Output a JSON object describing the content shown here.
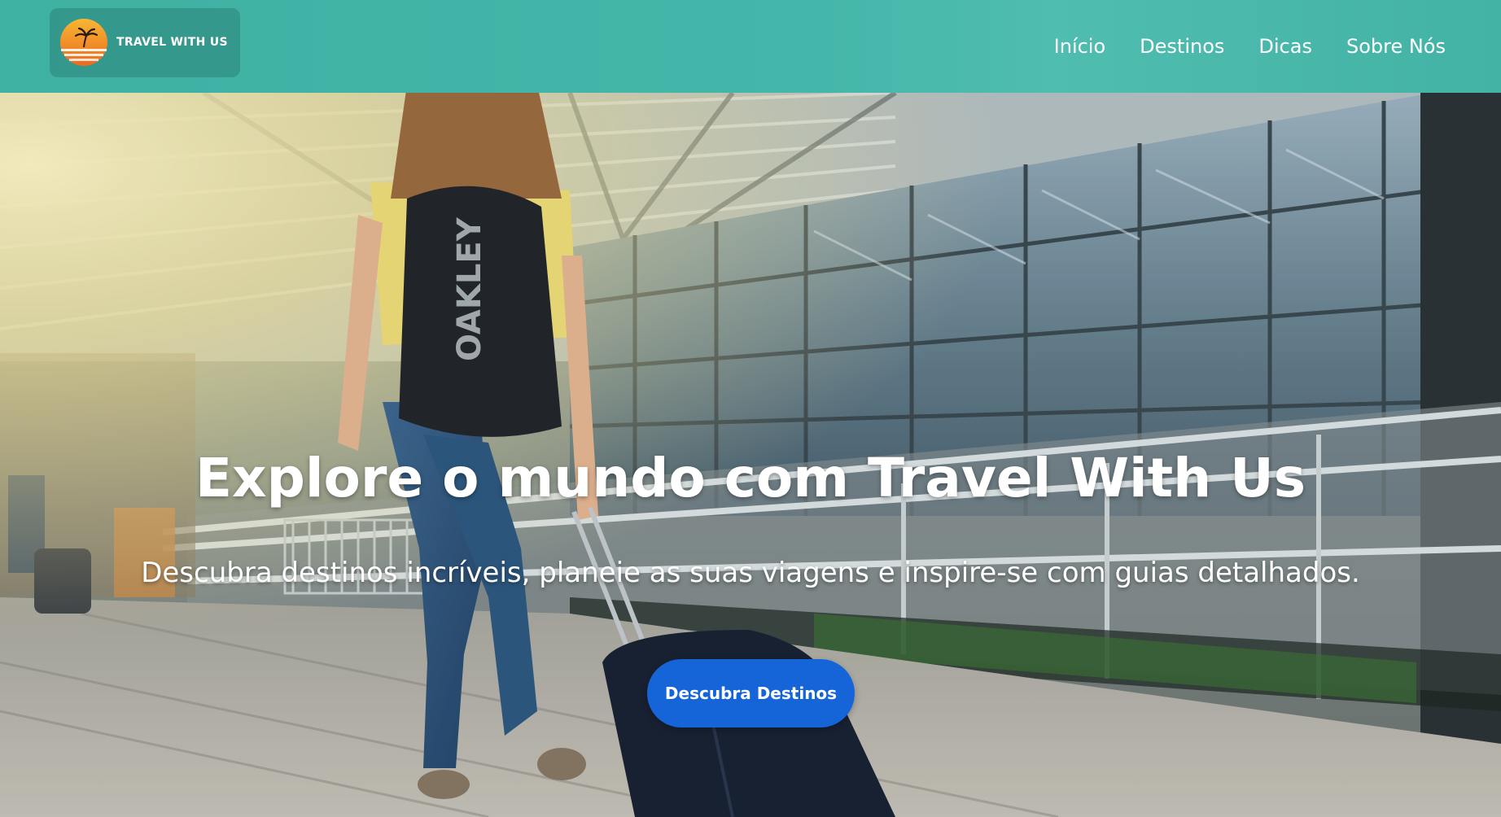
{
  "header": {
    "logo_text": "TRAVEL WITH US",
    "nav": [
      {
        "label": "Início"
      },
      {
        "label": "Destinos"
      },
      {
        "label": "Dicas"
      },
      {
        "label": "Sobre Nós"
      }
    ]
  },
  "hero": {
    "title": "Explore o mundo com Travel With Us",
    "subtitle": "Descubra destinos incríveis, planeie as suas viagens e inspire-se com guias detalhados.",
    "cta_label": "Descubra Destinos",
    "background_image": "traveler-with-backpack-and-suitcase-at-airport-terminal"
  },
  "colors": {
    "header_bg": "#45b7aa",
    "cta_bg": "#1565d8",
    "text": "#ffffff"
  }
}
